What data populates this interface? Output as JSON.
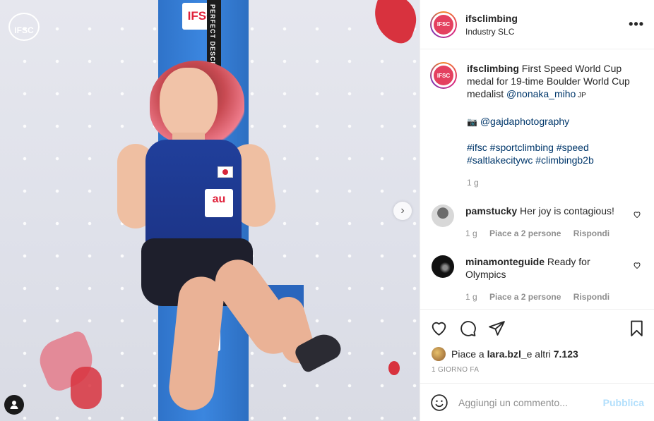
{
  "post": {
    "account": "ifsclimbing",
    "location": "Industry SLC",
    "avatar_text": "IFSC",
    "more_icon": "more-horizontal-icon"
  },
  "photo": {
    "logo_text": "IFSC",
    "rope_text": "PERFECT DESCENT",
    "banner_text": "IFSC",
    "bib_text": "au",
    "next_arrow": "›"
  },
  "caption": {
    "username": "ifsclimbing",
    "text": " First Speed World Cup medal for 19-time Boulder World Cup medalist ",
    "mention": "@nonaka_miho",
    "mention_suffix": " JP",
    "camera_icon": "camera-icon",
    "photo_credit": "@gajdaphotography",
    "hashtags_line1": "#ifsc #sportclimbing #speed",
    "hashtags_line2": "#saltlakecitywc #climbingb2b",
    "time": "1 g"
  },
  "comments": [
    {
      "username": "pamstucky",
      "text": " Her joy is contagious!",
      "time": "1 g",
      "likes": "Piace a 2 persone",
      "reply": "Rispondi"
    },
    {
      "username": "minamonteguide",
      "text": " Ready for Olympics",
      "time": "1 g",
      "likes": "Piace a 2 persone",
      "reply": "Rispondi"
    }
  ],
  "likes": {
    "prefix": "Piace a ",
    "user": "lara.bzl_",
    "suffix": " e altri ",
    "count": "7.123"
  },
  "date": "1 GIORNO FA",
  "add_comment": {
    "placeholder": "Aggiungi un commento...",
    "publish": "Pubblica"
  },
  "colors": {
    "link": "#00376b",
    "muted": "#8e8e8e",
    "publish_disabled": "#b2dffc",
    "banner_blue": "#2f73c9"
  }
}
